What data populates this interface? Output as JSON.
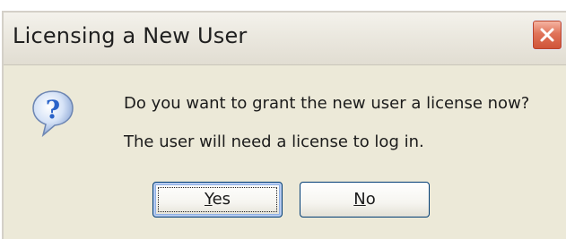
{
  "window": {
    "title": "Licensing a New User",
    "close_icon": "close-icon"
  },
  "message": {
    "icon": "question-icon",
    "line1": "Do you want to grant the new user a license now?",
    "line2": "The user will need a license to log in."
  },
  "buttons": {
    "yes": {
      "mnemonic": "Y",
      "rest": "es",
      "focused": true
    },
    "no": {
      "mnemonic": "N",
      "rest": "o",
      "focused": false
    }
  },
  "colors": {
    "dialog_background": "#ece9d8",
    "close_button": "#e0745a",
    "button_border": "#003c74",
    "focus_highlight": "#8fb0e6",
    "question_icon": "#2a63c9"
  }
}
